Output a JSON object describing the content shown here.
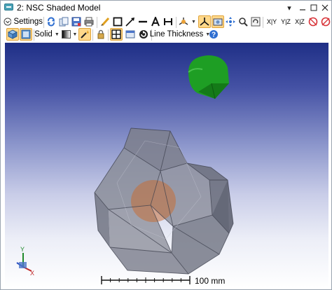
{
  "window": {
    "title": "2: NSC Shaded Model"
  },
  "toolbar1": {
    "settings_label": "Settings",
    "view_labels": [
      "X|Y",
      "Y|Z",
      "X|Z"
    ]
  },
  "toolbar2": {
    "solid_label": "Solid",
    "line_thickness_label": "Line Thickness"
  },
  "viewport": {
    "scale_label": "100 mm",
    "axis_labels": {
      "x": "X",
      "y": "Y"
    }
  },
  "colors": {
    "viewport_top": "#1f2f86",
    "sphere_green": "#1e9e24",
    "solid_gray": "#8a8d9b",
    "inner_orange": "#c96a2c",
    "active_button": "#ffd88a"
  }
}
